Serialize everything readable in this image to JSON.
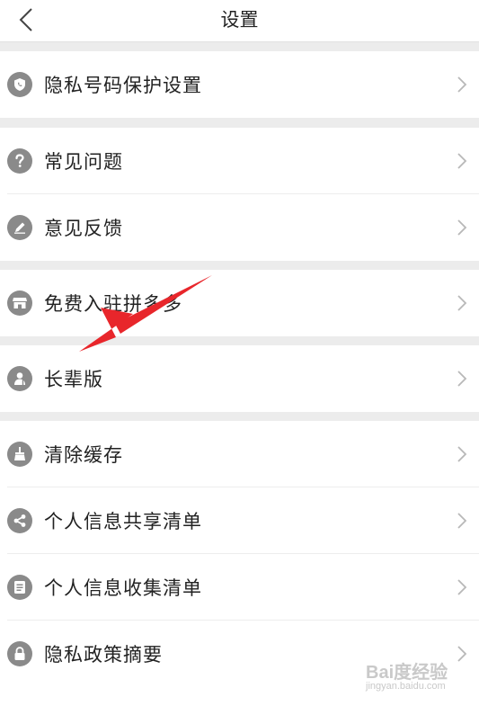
{
  "header": {
    "title": "设置",
    "back_icon": "chevron-left-icon"
  },
  "groups": [
    [
      {
        "label": "隐私号码保护设置",
        "icon": "shield-phone-icon"
      }
    ],
    [
      {
        "label": "常见问题",
        "icon": "question-icon"
      },
      {
        "label": "意见反馈",
        "icon": "pencil-icon"
      }
    ],
    [
      {
        "label": "免费入驻拼多多",
        "icon": "store-icon"
      }
    ],
    [
      {
        "label": "长辈版",
        "icon": "elder-icon"
      }
    ],
    [
      {
        "label": "清除缓存",
        "icon": "broom-icon"
      },
      {
        "label": "个人信息共享清单",
        "icon": "share-icon"
      },
      {
        "label": "个人信息收集清单",
        "icon": "list-icon"
      },
      {
        "label": "隐私政策摘要",
        "icon": "lock-icon"
      }
    ]
  ],
  "annotation": {
    "color": "#e8262b"
  },
  "watermark": {
    "brand": "Bai度经验",
    "sub": "jingyan.baidu.com"
  },
  "colors": {
    "icon_bg": "#8a8a8a",
    "separator": "#ececec",
    "chevron": "#b8b8b8"
  }
}
